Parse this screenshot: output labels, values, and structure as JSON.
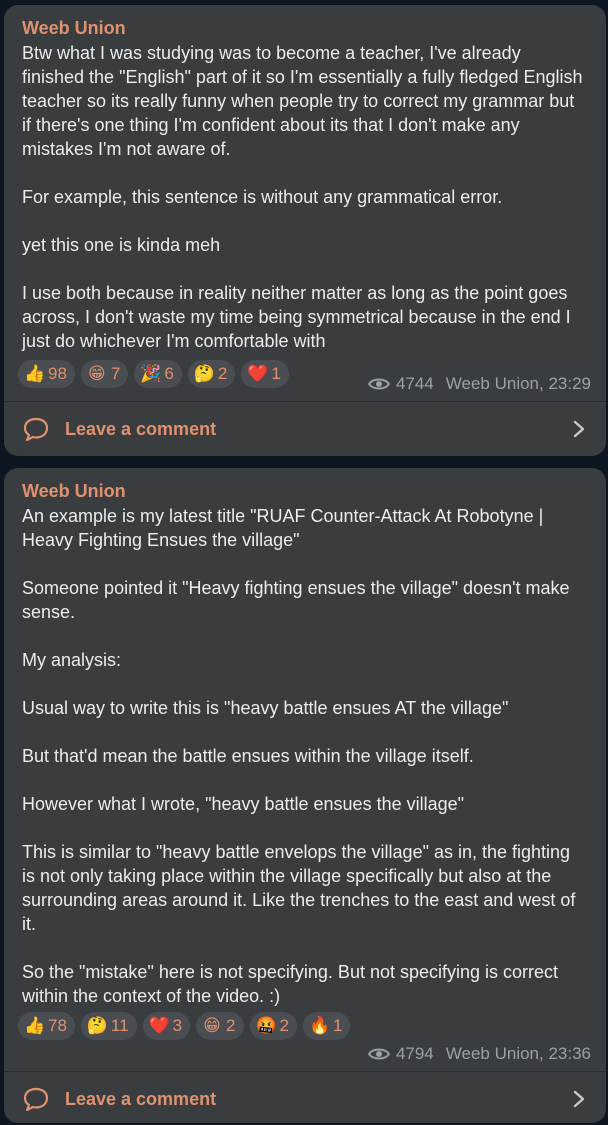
{
  "posts": [
    {
      "author": "Weeb Union",
      "text": "Btw what I was studying was to become a teacher, I've already finished the \"English\" part of it so I'm essentially a fully fledged English teacher so its really funny when people try to correct my grammar but if there's one thing I'm confident about its that I don't make any mistakes I'm not aware of.\n\nFor example, this sentence is without any grammatical error.\n\nyet this one is kinda meh\n\nI use both because in reality neither matter as long as the point goes across, I don't waste my time being symmetrical because in the end I just do whichever I'm comfortable with",
      "reactions": [
        {
          "emoji": "👍",
          "icon": "thumbs-up",
          "count": "98"
        },
        {
          "emoji": "😁",
          "icon": "grin",
          "count": "7"
        },
        {
          "emoji": "🎉",
          "icon": "party-popper",
          "count": "6"
        },
        {
          "emoji": "🤔",
          "icon": "thinking-face",
          "count": "2"
        },
        {
          "emoji": "❤️",
          "icon": "red-heart",
          "count": "1"
        }
      ],
      "views": "4744",
      "signature": "Weeb Union, 23:29",
      "comment_label": "Leave a comment"
    },
    {
      "author": "Weeb Union",
      "text": "An example is my latest title \"RUAF Counter-Attack At Robotyne | Heavy Fighting Ensues the village\"\n\nSomeone pointed it \"Heavy fighting ensues the village\" doesn't make sense.\n\nMy analysis:\n\nUsual way to write this is \"heavy battle ensues AT the village\"\n\nBut that'd mean the battle ensues within the village itself.\n\nHowever what I wrote, \"heavy battle ensues the village\"\n\nThis is similar to \"heavy battle envelops the village\" as in, the fighting is not only taking place within the village specifically but also at the surrounding areas around it. Like the trenches to the east and west of it.\n\nSo the \"mistake\" here is not specifying. But not specifying is correct within the context of the video. :)",
      "reactions": [
        {
          "emoji": "👍",
          "icon": "thumbs-up",
          "count": "78"
        },
        {
          "emoji": "🤔",
          "icon": "thinking-face",
          "count": "11"
        },
        {
          "emoji": "❤️",
          "icon": "red-heart",
          "count": "3"
        },
        {
          "emoji": "😁",
          "icon": "grin",
          "count": "2"
        },
        {
          "emoji": "🤬",
          "icon": "cursing-face",
          "count": "2"
        },
        {
          "emoji": "🔥",
          "icon": "fire",
          "count": "1"
        }
      ],
      "views": "4794",
      "signature": "Weeb Union, 23:36",
      "comment_label": "Leave a comment"
    }
  ],
  "colors": {
    "background": "#0e1621",
    "bubble": "#3a3d40",
    "accent": "#e0916e",
    "muted": "#9aa0a6"
  }
}
